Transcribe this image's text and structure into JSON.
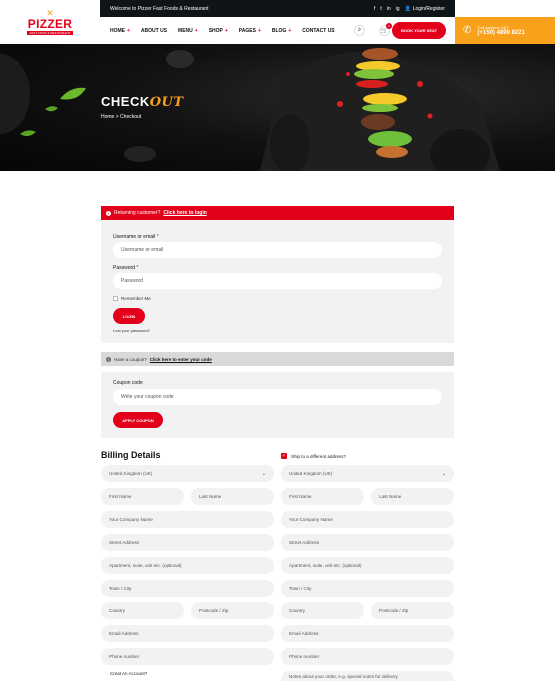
{
  "header": {
    "logo_name": "PIZZER",
    "logo_tag": "FAST FOOD & RESTAURANT",
    "welcome": "Welcome to Pizzer Fast Foods & Restaurant",
    "social": [
      "f",
      "t",
      "in",
      "ig"
    ],
    "login_register": "Login/Register",
    "nav": [
      {
        "label": "HOME",
        "has_sub": true
      },
      {
        "label": "ABOUT US",
        "has_sub": false
      },
      {
        "label": "MENU",
        "has_sub": true
      },
      {
        "label": "SHOP",
        "has_sub": true
      },
      {
        "label": "PAGES",
        "has_sub": true
      },
      {
        "label": "BLOG",
        "has_sub": true
      },
      {
        "label": "CONTACT US",
        "has_sub": false
      }
    ],
    "cart_count": "0",
    "book_button": "BOOK YOUR SEAT",
    "call_label": "Call Anytime 24/7",
    "call_number": "(+150) 4899 8221"
  },
  "hero": {
    "title_main": "CHECK",
    "title_accent": "OUT",
    "breadcrumb": [
      "Home",
      "Checkout"
    ]
  },
  "login_section": {
    "notice_text": "Returning customer?",
    "notice_link": "Click here to login",
    "username_label": "Username or email",
    "username_placeholder": "Username or email",
    "password_label": "Password",
    "password_placeholder": "Password",
    "remember_label": "Remember Me",
    "login_button": "LOGIN",
    "lost_password": "Lost your password?"
  },
  "coupon_section": {
    "bar_text": "Have a coupon?",
    "bar_link": "Click here to enter your code",
    "code_label": "Coupon code",
    "code_placeholder": "Write your coupon code",
    "apply_button": "APPLY COUPON"
  },
  "billing": {
    "title": "Billing Details",
    "country": "United Kingdom (UK)",
    "first_name": "First Name",
    "last_name": "Last Name",
    "company": "Your Company Name",
    "street": "Street Address",
    "apartment": "Apartment, suite, unit etc. (optional)",
    "town": "Town / City",
    "country_field": "Country",
    "postcode": "Postcode / Zip",
    "email": "Email Address",
    "phone": "Phone number",
    "create_account": "Creat An Account?"
  },
  "shipping": {
    "ship_label": "Ship to a different address?",
    "country": "United Kingdom (UK)",
    "first_name": "First Name",
    "last_name": "Last Name",
    "company": "Your Company Name",
    "street": "Street Address",
    "apartment": "Apartment, suite, unit etc. (optional)",
    "town": "Town / City",
    "country_field": "Country",
    "postcode": "Postcode / Zip",
    "email": "Email Address",
    "phone": "Phone number",
    "notes": "Notes about your order, e.g. special notes for delivery"
  },
  "colors": {
    "brand_red": "#e3001b",
    "accent_orange": "#f9a11b",
    "dark": "#0f1419"
  }
}
